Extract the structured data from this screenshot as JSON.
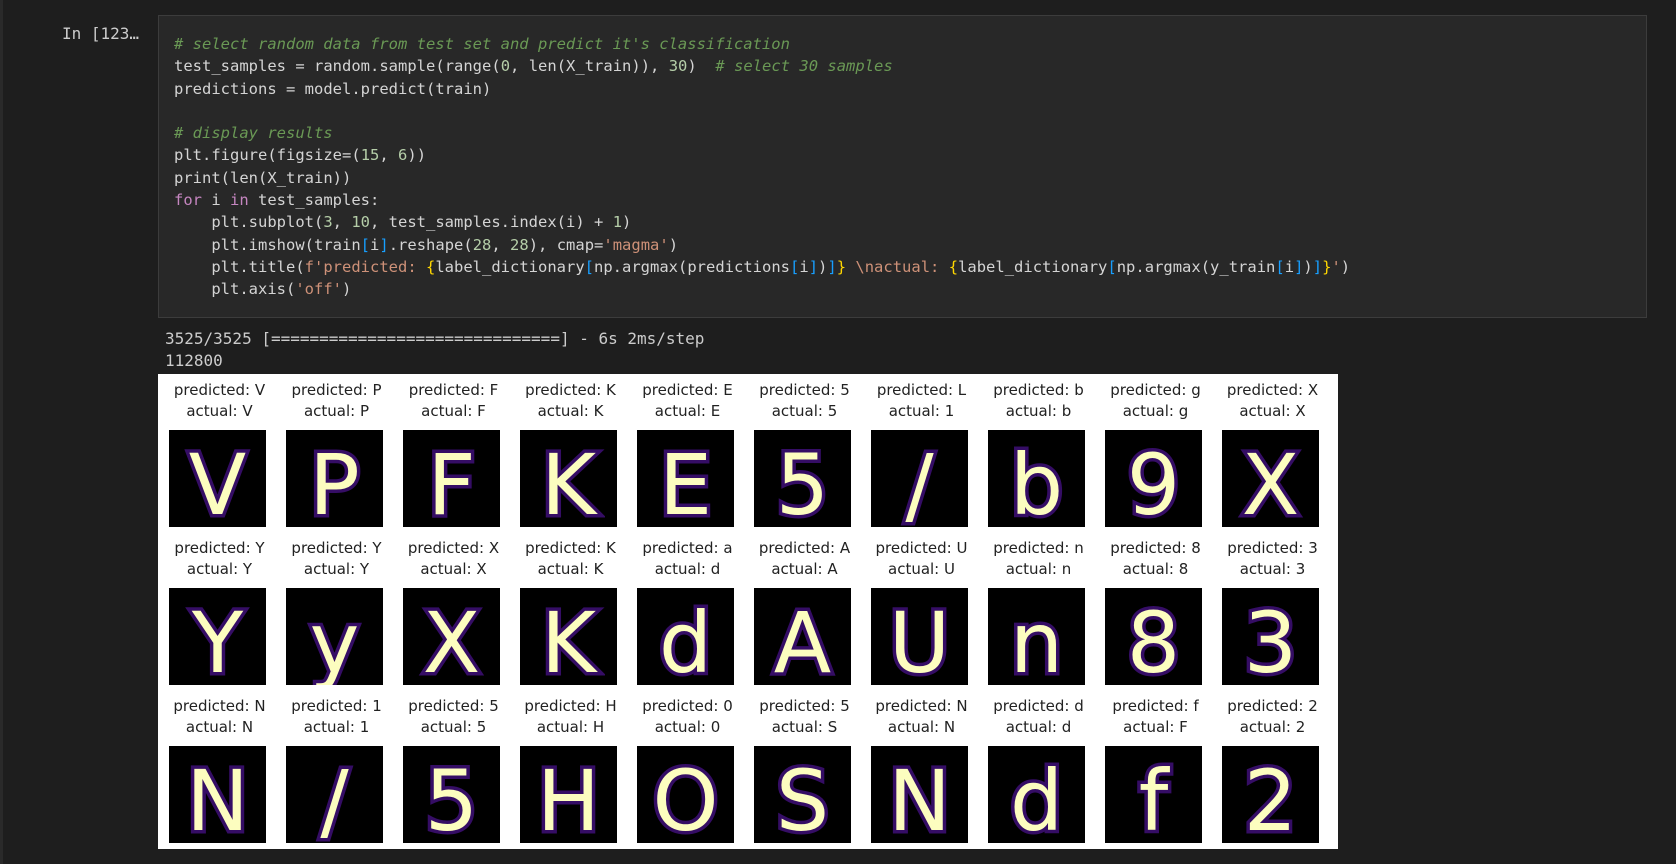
{
  "cell": {
    "prompt": "In [123…",
    "code_lines": [
      [
        {
          "t": "# select random data from test set and predict it's classification",
          "c": "comment"
        }
      ],
      [
        {
          "t": "test_samples ",
          "c": "op"
        },
        {
          "t": "=",
          "c": "op"
        },
        {
          "t": " random",
          "c": "op"
        },
        {
          "t": ".",
          "c": "op"
        },
        {
          "t": "sample",
          "c": "op"
        },
        {
          "t": "(",
          "c": "op"
        },
        {
          "t": "range",
          "c": "op"
        },
        {
          "t": "(",
          "c": "op"
        },
        {
          "t": "0",
          "c": "number"
        },
        {
          "t": ", ",
          "c": "op"
        },
        {
          "t": "len",
          "c": "op"
        },
        {
          "t": "(X_train)), ",
          "c": "op"
        },
        {
          "t": "30",
          "c": "number"
        },
        {
          "t": ")  ",
          "c": "op"
        },
        {
          "t": "# select 30 samples",
          "c": "comment"
        }
      ],
      [
        {
          "t": "predictions ",
          "c": "op"
        },
        {
          "t": "=",
          "c": "op"
        },
        {
          "t": " model",
          "c": "op"
        },
        {
          "t": ".",
          "c": "op"
        },
        {
          "t": "predict(train)",
          "c": "op"
        }
      ],
      [
        {
          "t": "",
          "c": "op"
        }
      ],
      [
        {
          "t": "# display results",
          "c": "comment"
        }
      ],
      [
        {
          "t": "plt",
          "c": "op"
        },
        {
          "t": ".",
          "c": "op"
        },
        {
          "t": "figure(figsize",
          "c": "op"
        },
        {
          "t": "=",
          "c": "op"
        },
        {
          "t": "(",
          "c": "op"
        },
        {
          "t": "15",
          "c": "number"
        },
        {
          "t": ", ",
          "c": "op"
        },
        {
          "t": "6",
          "c": "number"
        },
        {
          "t": "))",
          "c": "op"
        }
      ],
      [
        {
          "t": "print",
          "c": "op"
        },
        {
          "t": "(",
          "c": "op"
        },
        {
          "t": "len",
          "c": "op"
        },
        {
          "t": "(X_train))",
          "c": "op"
        }
      ],
      [
        {
          "t": "for",
          "c": "keyword"
        },
        {
          "t": " i ",
          "c": "op"
        },
        {
          "t": "in",
          "c": "keyword"
        },
        {
          "t": " test_samples:",
          "c": "op"
        }
      ],
      [
        {
          "t": "    plt",
          "c": "op"
        },
        {
          "t": ".",
          "c": "op"
        },
        {
          "t": "subplot(",
          "c": "op"
        },
        {
          "t": "3",
          "c": "number"
        },
        {
          "t": ", ",
          "c": "op"
        },
        {
          "t": "10",
          "c": "number"
        },
        {
          "t": ", test_samples",
          "c": "op"
        },
        {
          "t": ".",
          "c": "op"
        },
        {
          "t": "index(i) ",
          "c": "op"
        },
        {
          "t": "+",
          "c": "op"
        },
        {
          "t": " ",
          "c": "op"
        },
        {
          "t": "1",
          "c": "number"
        },
        {
          "t": ")",
          "c": "op"
        }
      ],
      [
        {
          "t": "    plt",
          "c": "op"
        },
        {
          "t": ".",
          "c": "op"
        },
        {
          "t": "imshow(train",
          "c": "op"
        },
        {
          "t": "[",
          "c": "bracket"
        },
        {
          "t": "i",
          "c": "op"
        },
        {
          "t": "]",
          "c": "bracket"
        },
        {
          "t": ".",
          "c": "op"
        },
        {
          "t": "reshape(",
          "c": "op"
        },
        {
          "t": "28",
          "c": "number"
        },
        {
          "t": ", ",
          "c": "op"
        },
        {
          "t": "28",
          "c": "number"
        },
        {
          "t": "), cmap",
          "c": "op"
        },
        {
          "t": "=",
          "c": "op"
        },
        {
          "t": "'magma'",
          "c": "string"
        },
        {
          "t": ")",
          "c": "op"
        }
      ],
      [
        {
          "t": "    plt",
          "c": "op"
        },
        {
          "t": ".",
          "c": "op"
        },
        {
          "t": "title(",
          "c": "op"
        },
        {
          "t": "f'predicted: ",
          "c": "string"
        },
        {
          "t": "{",
          "c": "brace"
        },
        {
          "t": "label_dictionary",
          "c": "op"
        },
        {
          "t": "[",
          "c": "bracket"
        },
        {
          "t": "np",
          "c": "op"
        },
        {
          "t": ".",
          "c": "op"
        },
        {
          "t": "argmax(predictions",
          "c": "op"
        },
        {
          "t": "[",
          "c": "bracket"
        },
        {
          "t": "i",
          "c": "op"
        },
        {
          "t": "]",
          "c": "bracket"
        },
        {
          "t": ")",
          "c": "op"
        },
        {
          "t": "]",
          "c": "bracket"
        },
        {
          "t": "}",
          "c": "brace"
        },
        {
          "t": " \\nactual: ",
          "c": "string"
        },
        {
          "t": "{",
          "c": "brace"
        },
        {
          "t": "label_dictionary",
          "c": "op"
        },
        {
          "t": "[",
          "c": "bracket"
        },
        {
          "t": "np",
          "c": "op"
        },
        {
          "t": ".",
          "c": "op"
        },
        {
          "t": "argmax(y_train",
          "c": "op"
        },
        {
          "t": "[",
          "c": "bracket"
        },
        {
          "t": "i",
          "c": "op"
        },
        {
          "t": "]",
          "c": "bracket"
        },
        {
          "t": ")",
          "c": "op"
        },
        {
          "t": "]",
          "c": "bracket"
        },
        {
          "t": "}",
          "c": "brace"
        },
        {
          "t": "'",
          "c": "string"
        },
        {
          "t": ")",
          "c": "op"
        }
      ],
      [
        {
          "t": "    plt",
          "c": "op"
        },
        {
          "t": ".",
          "c": "op"
        },
        {
          "t": "axis(",
          "c": "op"
        },
        {
          "t": "'off'",
          "c": "string"
        },
        {
          "t": ")",
          "c": "op"
        }
      ]
    ],
    "output_progress": "3525/3525 [==============================] - 6s 2ms/step",
    "output_count": "112800"
  },
  "colors": {
    "image_background": "#000000",
    "stroke_outer": "#3b0f70",
    "stroke_mid": "#fcfdbf",
    "stroke_inner": "#fcfdbf"
  },
  "samples": [
    {
      "predicted": "predicted: V",
      "actual": "actual: V",
      "glyph": "V"
    },
    {
      "predicted": "predicted: P",
      "actual": "actual: P",
      "glyph": "P"
    },
    {
      "predicted": "predicted: F",
      "actual": "actual: F",
      "glyph": "F"
    },
    {
      "predicted": "predicted: K",
      "actual": "actual: K",
      "glyph": "K"
    },
    {
      "predicted": "predicted: E",
      "actual": "actual: E",
      "glyph": "E"
    },
    {
      "predicted": "predicted: 5",
      "actual": "actual: 5",
      "glyph": "5"
    },
    {
      "predicted": "predicted: L",
      "actual": "actual: 1",
      "glyph": "/"
    },
    {
      "predicted": "predicted: b",
      "actual": "actual: b",
      "glyph": "b"
    },
    {
      "predicted": "predicted: g",
      "actual": "actual: g",
      "glyph": "9"
    },
    {
      "predicted": "predicted: X",
      "actual": "actual: X",
      "glyph": "X"
    },
    {
      "predicted": "predicted: Y",
      "actual": "actual: Y",
      "glyph": "Y"
    },
    {
      "predicted": "predicted: Y",
      "actual": "actual: Y",
      "glyph": "y"
    },
    {
      "predicted": "predicted: X",
      "actual": "actual: X",
      "glyph": "X"
    },
    {
      "predicted": "predicted: K",
      "actual": "actual: K",
      "glyph": "K"
    },
    {
      "predicted": "predicted: a",
      "actual": "actual: d",
      "glyph": "d"
    },
    {
      "predicted": "predicted: A",
      "actual": "actual: A",
      "glyph": "A"
    },
    {
      "predicted": "predicted: U",
      "actual": "actual: U",
      "glyph": "U"
    },
    {
      "predicted": "predicted: n",
      "actual": "actual: n",
      "glyph": "n"
    },
    {
      "predicted": "predicted: 8",
      "actual": "actual: 8",
      "glyph": "8"
    },
    {
      "predicted": "predicted: 3",
      "actual": "actual: 3",
      "glyph": "3"
    },
    {
      "predicted": "predicted: N",
      "actual": "actual: N",
      "glyph": "N"
    },
    {
      "predicted": "predicted: 1",
      "actual": "actual: 1",
      "glyph": "/"
    },
    {
      "predicted": "predicted: 5",
      "actual": "actual: 5",
      "glyph": "5"
    },
    {
      "predicted": "predicted: H",
      "actual": "actual: H",
      "glyph": "H"
    },
    {
      "predicted": "predicted: 0",
      "actual": "actual: 0",
      "glyph": "O"
    },
    {
      "predicted": "predicted: 5",
      "actual": "actual: S",
      "glyph": "S"
    },
    {
      "predicted": "predicted: N",
      "actual": "actual: N",
      "glyph": "N"
    },
    {
      "predicted": "predicted: d",
      "actual": "actual: d",
      "glyph": "d"
    },
    {
      "predicted": "predicted: f",
      "actual": "actual: F",
      "glyph": "f"
    },
    {
      "predicted": "predicted: 2",
      "actual": "actual: 2",
      "glyph": "2"
    }
  ]
}
